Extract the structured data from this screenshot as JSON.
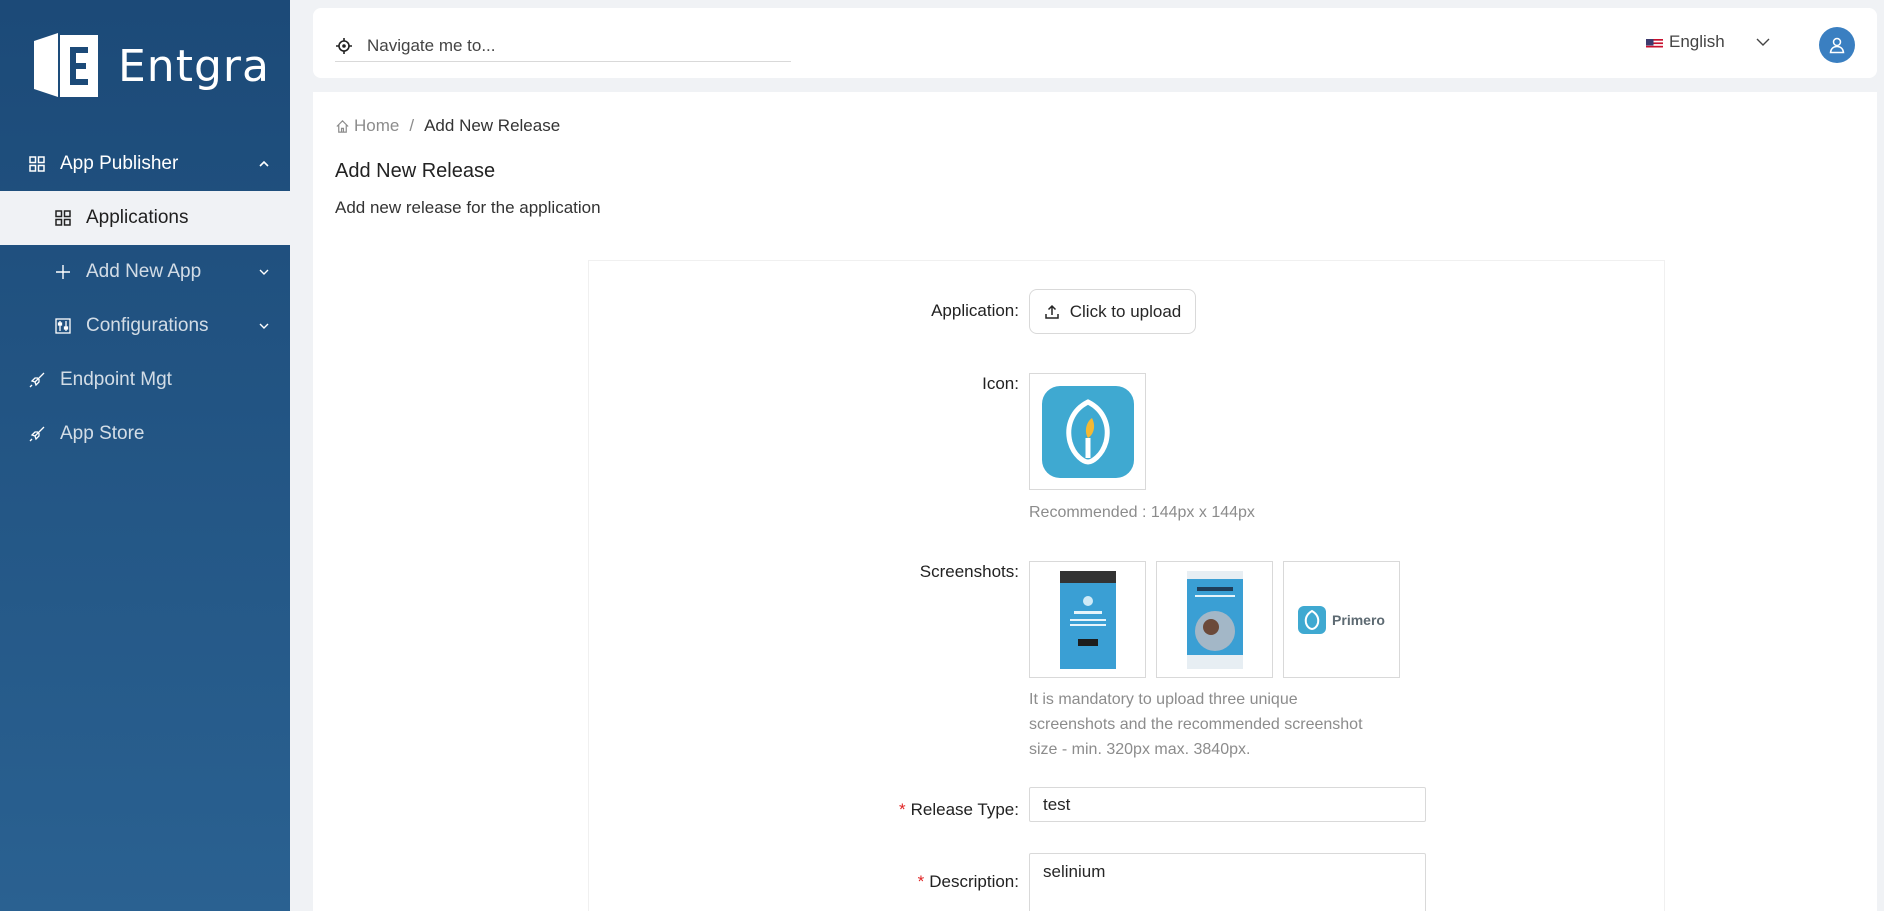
{
  "brand": {
    "name": "Entgra"
  },
  "sidebar": {
    "items": [
      {
        "label": "App Publisher",
        "icon": "grid-icon",
        "expanded": true
      },
      {
        "label": "Applications",
        "icon": "grid-icon",
        "active": true
      },
      {
        "label": "Add New App",
        "icon": "plus-icon"
      },
      {
        "label": "Configurations",
        "icon": "sliders-icon"
      },
      {
        "label": "Endpoint Mgt",
        "icon": "rocket-icon"
      },
      {
        "label": "App Store",
        "icon": "rocket-icon"
      }
    ]
  },
  "header": {
    "nav_placeholder": "Navigate me to...",
    "language": "English",
    "accent": "#3a7fc1"
  },
  "breadcrumb": {
    "home": "Home",
    "separator": "/",
    "current": "Add New Release"
  },
  "page": {
    "title": "Add New Release",
    "subtitle": "Add new release for the application"
  },
  "form": {
    "application_label": "Application",
    "upload_label": "Click to upload",
    "icon_label": "Icon",
    "icon_hint": "Recommended : 144px x 144px",
    "screenshots_label": "Screenshots",
    "screenshot_hint": [
      "It is mandatory to upload three unique",
      "screenshots and the recommended screenshot",
      "size - min. 320px max. 3840px."
    ],
    "screenshot_3_text": "Primero",
    "release_type_label": "Release Type",
    "release_type_value": "test",
    "description_label": "Description",
    "description_value": "selinium",
    "label_colon": ":"
  },
  "colors": {
    "sidebar_top": "#1c4a78",
    "sidebar_bottom": "#2a6191",
    "required": "#e02424",
    "app_icon": "#3fa9d1"
  }
}
